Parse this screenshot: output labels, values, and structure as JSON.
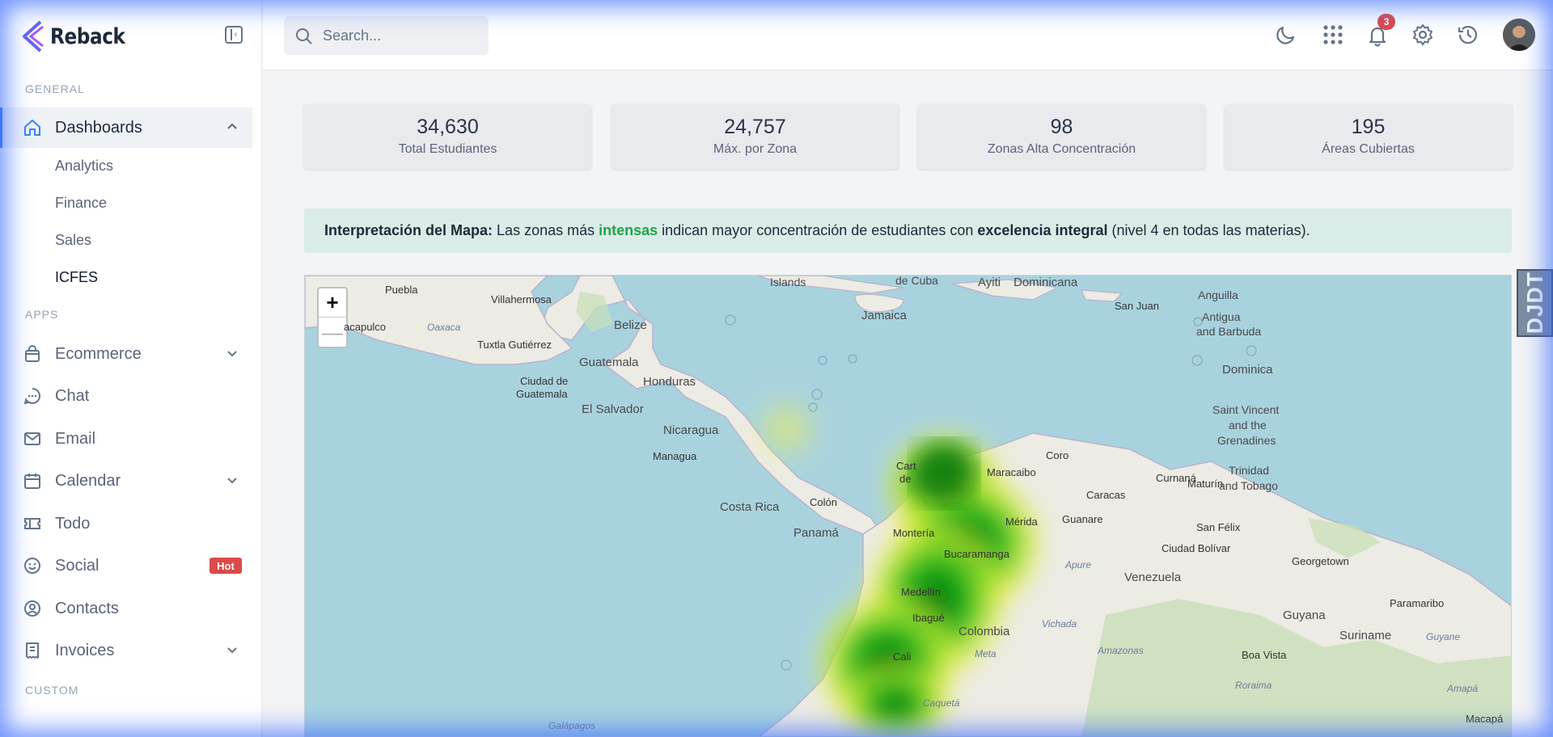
{
  "brand": {
    "name": "Reback"
  },
  "sidebar": {
    "sections": {
      "general": "GENERAL",
      "apps": "APPS",
      "custom": "CUSTOM"
    },
    "dashboards": {
      "label": "Dashboards",
      "children": [
        "Analytics",
        "Finance",
        "Sales",
        "ICFES"
      ]
    },
    "apps": [
      {
        "label": "Ecommerce"
      },
      {
        "label": "Chat"
      },
      {
        "label": "Email"
      },
      {
        "label": "Calendar"
      },
      {
        "label": "Todo"
      },
      {
        "label": "Social",
        "badge": "Hot"
      },
      {
        "label": "Contacts"
      },
      {
        "label": "Invoices"
      }
    ]
  },
  "header": {
    "search_placeholder": "Search...",
    "notifications_count": "3"
  },
  "stats": [
    {
      "value": "34,630",
      "caption": "Total Estudiantes"
    },
    {
      "value": "24,757",
      "caption": "Máx. por Zona"
    },
    {
      "value": "98",
      "caption": "Zonas Alta Concentración"
    },
    {
      "value": "195",
      "caption": "Áreas Cubiertas"
    }
  ],
  "alert": {
    "lead": "Interpretación del Mapa:",
    "t1": " Las zonas más ",
    "highlight": "intensas",
    "t2": " indican mayor concentración de estudiantes con ",
    "bold2": "excelencia integral",
    "t3": " (nivel 4 en todas las materias)."
  },
  "map": {
    "zoom_in": "+",
    "zoom_out": "—",
    "labels": [
      "Islands",
      "de Cuba",
      "Ayiti",
      "Dominicana",
      "Puebla",
      "Villahermosa",
      "Jamaica",
      "San Juan",
      "Anguilla",
      "Antigua",
      "and Barbuda",
      "acapulco",
      "Oaxaca",
      "Belize",
      "Tuxtla Gutiérrez",
      "Guatemala",
      "Ciudad de",
      "Guatemala",
      "Honduras",
      "El Salvador",
      "Dominica",
      "Nicaragua",
      "Managua",
      "Saint Vincent",
      "and the",
      "Grenadines",
      "Coro",
      "Cart",
      "de",
      "Maracaibo",
      "Curnaná",
      "Trinidad",
      "and Tobago",
      "Caracas",
      "Maturín",
      "Costa Rica",
      "Colón",
      "Mérida",
      "Guanare",
      "San Félix",
      "Panamá",
      "Montería",
      "Ciudad Bolívar",
      "Bucaramanga",
      "Apure",
      "Venezuela",
      "Georgetown",
      "Medellín",
      "Paramaribo",
      "Ibagué",
      "Colombia",
      "Vichada",
      "Guyana",
      "Suriname",
      "Guyane",
      "Meta",
      "Amazonas",
      "Boa Vista",
      "Cali",
      "Roraima",
      "Amapá",
      "Caquetá",
      "Galápagos",
      "Macapá"
    ]
  },
  "side_tab": {
    "text": "DJDT"
  },
  "colors": {
    "accent": "#3b82f6",
    "badge": "#dc4a4a",
    "alert_bg": "#d9ece8",
    "highlight": "#22a34a",
    "sea": "#a9d2df",
    "land": "#ecebe4"
  },
  "icons": [
    "home-icon",
    "bag-icon",
    "chat-icon",
    "mail-icon",
    "calendar-icon",
    "ticket-icon",
    "smile-icon",
    "user-circle-icon",
    "receipt-icon",
    "search-icon",
    "moon-icon",
    "apps-grid-icon",
    "bell-icon",
    "gear-icon",
    "history-icon"
  ]
}
